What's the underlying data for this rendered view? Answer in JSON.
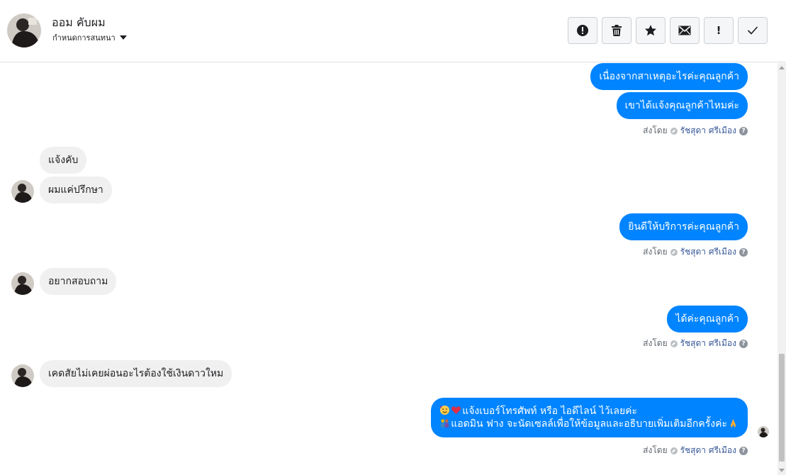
{
  "header": {
    "name": "ออม คับผม",
    "subtitle": "กำหนดการสนทนา",
    "actions": [
      {
        "icon": "exclamation-circle-icon"
      },
      {
        "icon": "trash-icon"
      },
      {
        "icon": "star-icon"
      },
      {
        "icon": "envelope-icon"
      },
      {
        "label": "!"
      },
      {
        "icon": "check-icon"
      }
    ]
  },
  "thread": {
    "m1": "เนื่องจากสาเหตุอะไรค่ะคุณลูกค้า",
    "m2": "เขาได้แจ้งคุณลูกค้าไหมค่ะ",
    "m3": "แจ้งคับ",
    "m4": "ผมแค่ปรึกษา",
    "m5": "ยินดีให้บริการค่ะคุณลูกค้า",
    "m6": "อยากสอบถาม",
    "m7": "ได้ค่ะคุณลูกค้า",
    "m8": "เคดสัยไม่เคยผ่อนอะไรต้องใช้เงินดาวใหม",
    "m9_line1": "แจ้งเบอร์โทรศัพท์ หรือ ไอดีไลน์  ไว้เลยค่ะ",
    "m9_line2": "แอดมิน ฟาง จะนัดเซลล์เพื่อให้ข้อมูลและอธิบายเพิ่มเติมอีกครั้งค่ะ"
  },
  "meta": {
    "sent_by": "ส่งโดย",
    "sender": "รัชสุดา ศรีเมือง",
    "help": "?"
  },
  "colors": {
    "outgoing": "#0084ff",
    "incoming": "#f1f0f0"
  }
}
